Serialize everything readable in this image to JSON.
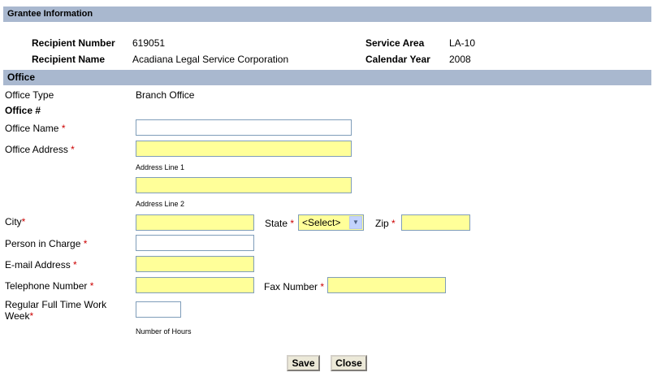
{
  "grantee": {
    "header": "Grantee Information",
    "recipient_number_label": "Recipient Number",
    "recipient_number": "619051",
    "recipient_name_label": "Recipient Name",
    "recipient_name": "Acadiana Legal Service Corporation",
    "service_area_label": "Service Area",
    "service_area": "LA-10",
    "calendar_year_label": "Calendar Year",
    "calendar_year": "2008"
  },
  "office": {
    "header": "Office",
    "office_type_label": "Office Type",
    "office_type": "Branch Office",
    "office_number_label": "Office #",
    "office_name_label": "Office Name",
    "office_address_label": "Office Address",
    "address_line1_caption": "Address Line 1",
    "address_line2_caption": "Address Line 2",
    "city_label": "City",
    "state_label": "State",
    "state_selected": "<Select>",
    "zip_label": "Zip",
    "person_label": "Person in Charge",
    "email_label": "E-mail Address",
    "telephone_label": "Telephone Number",
    "fax_label": "Fax Number",
    "workweek_label_line1": "Regular Full Time Work",
    "workweek_label_line2": "Week",
    "hours_caption": "Number of Hours",
    "required_marker": "*"
  },
  "fields": {
    "office_name": "",
    "address1": "",
    "address2": "",
    "city": "",
    "zip": "",
    "person": "",
    "email": "",
    "telephone": "",
    "fax": "",
    "hours": ""
  },
  "buttons": {
    "save": "Save",
    "close": "Close"
  },
  "colors": {
    "section_bar": "#a9b8cf",
    "required_field_bg": "#ffff99",
    "required_marker": "#cc0000"
  }
}
